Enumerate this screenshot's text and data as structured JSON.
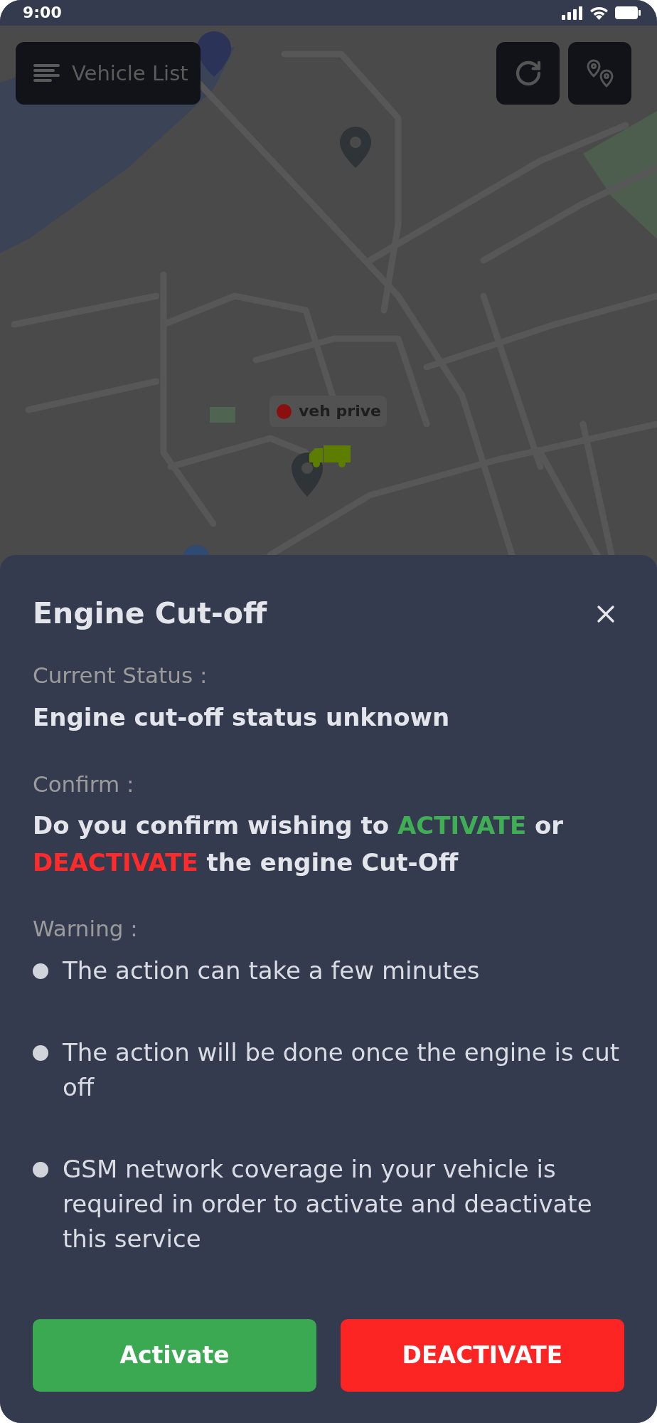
{
  "status_bar": {
    "time": "9:00"
  },
  "toolbar": {
    "vehicle_list_button": "Vehicle List"
  },
  "map": {
    "vehicles": [
      {
        "label": "veh prive",
        "color": "#8a1010"
      }
    ]
  },
  "sheet": {
    "title": "Engine Cut-off",
    "current_status": {
      "label": "Current Status :",
      "value": "Engine cut-off status unknown"
    },
    "confirm": {
      "label": "Confirm :",
      "parts": [
        {
          "text": "Do you confirm wishing to "
        },
        {
          "text": "ACTIVATE",
          "color": "#3fae55"
        },
        {
          "text": " or "
        },
        {
          "text": "DEACTIVATE",
          "color": "#ff2b2b"
        },
        {
          "text": " the engine Cut-Off"
        }
      ]
    },
    "warning": {
      "label": "Warning :",
      "items": [
        "The action can take a few minutes",
        "The action will be done once the engine is cut off",
        "GSM network coverage in your vehicle is required in order to activate and deactivate this service"
      ]
    },
    "buttons": [
      {
        "label": "Activate",
        "kind": "activate"
      },
      {
        "label": "DEACTIVATE",
        "kind": "deactivate"
      }
    ]
  }
}
